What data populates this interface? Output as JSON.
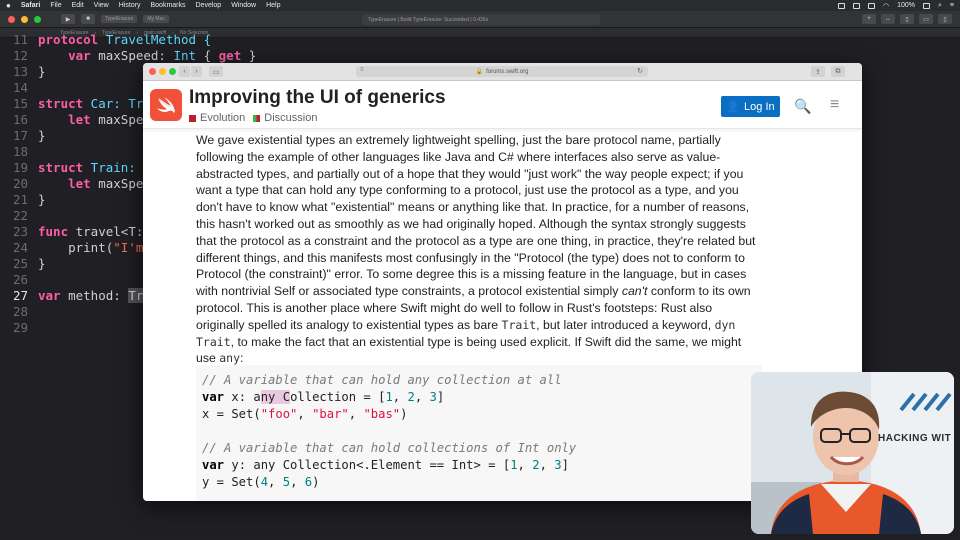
{
  "menubar": {
    "app": "Safari",
    "items": [
      "File",
      "Edit",
      "View",
      "History",
      "Bookmarks",
      "Develop",
      "Window",
      "Help"
    ],
    "battery": "100%",
    "clock": ""
  },
  "xcode": {
    "scheme": "TypeErasure",
    "device": "My Mac",
    "status": "TypeErasure | Build TypeErasure: Succeeded | 0.435s",
    "jump": [
      "TypeErasure",
      "TypeErasure",
      "main.swift",
      "No Selection"
    ]
  },
  "code": [
    {
      "ln": "11",
      "parts": [
        {
          "t": "protocol",
          "c": "kw"
        },
        {
          "t": " TravelMethod {",
          "c": "ty"
        }
      ]
    },
    {
      "ln": "12",
      "parts": [
        {
          "t": "    ",
          "c": "pl"
        },
        {
          "t": "var",
          "c": "kw"
        },
        {
          "t": " maxSpeed: ",
          "c": "pl"
        },
        {
          "t": "Int",
          "c": "ty"
        },
        {
          "t": " { ",
          "c": "pl"
        },
        {
          "t": "get",
          "c": "kw"
        },
        {
          "t": " }",
          "c": "pl"
        }
      ]
    },
    {
      "ln": "13",
      "parts": [
        {
          "t": "}",
          "c": "pl"
        }
      ]
    },
    {
      "ln": "14",
      "parts": []
    },
    {
      "ln": "15",
      "parts": [
        {
          "t": "struct",
          "c": "kw"
        },
        {
          "t": " Car: Tr",
          "c": "ty"
        }
      ]
    },
    {
      "ln": "16",
      "parts": [
        {
          "t": "    ",
          "c": "pl"
        },
        {
          "t": "let",
          "c": "kw"
        },
        {
          "t": " maxSpe",
          "c": "pl"
        }
      ]
    },
    {
      "ln": "17",
      "parts": [
        {
          "t": "}",
          "c": "pl"
        }
      ]
    },
    {
      "ln": "18",
      "parts": []
    },
    {
      "ln": "19",
      "parts": [
        {
          "t": "struct",
          "c": "kw"
        },
        {
          "t": " Train: ",
          "c": "ty"
        }
      ]
    },
    {
      "ln": "20",
      "parts": [
        {
          "t": "    ",
          "c": "pl"
        },
        {
          "t": "let",
          "c": "kw"
        },
        {
          "t": " maxSpe",
          "c": "pl"
        }
      ]
    },
    {
      "ln": "21",
      "parts": [
        {
          "t": "}",
          "c": "pl"
        }
      ]
    },
    {
      "ln": "22",
      "parts": []
    },
    {
      "ln": "23",
      "parts": [
        {
          "t": "func",
          "c": "kw"
        },
        {
          "t": " travel<T:",
          "c": "pl"
        }
      ]
    },
    {
      "ln": "24",
      "parts": [
        {
          "t": "    print(",
          "c": "pl"
        },
        {
          "t": "\"I'm",
          "c": "st"
        }
      ]
    },
    {
      "ln": "25",
      "parts": [
        {
          "t": "}",
          "c": "pl"
        }
      ]
    },
    {
      "ln": "26",
      "parts": []
    },
    {
      "ln": "27",
      "active": true,
      "parts": [
        {
          "t": "var",
          "c": "kw"
        },
        {
          "t": " method: ",
          "c": "pl"
        },
        {
          "t": "Tr",
          "c": "sel"
        }
      ]
    },
    {
      "ln": "28",
      "parts": []
    },
    {
      "ln": "29",
      "parts": []
    }
  ],
  "safari": {
    "address": "forums.swift.org"
  },
  "site": {
    "title": "Improving the UI of generics",
    "categories": [
      {
        "name": "Evolution",
        "color": "#bf1e2e"
      },
      {
        "name": "Discussion",
        "color": "#3ab54a"
      }
    ],
    "login_label": "Log In"
  },
  "post": {
    "p1": "We gave existential types an extremely lightweight spelling, just the bare protocol name, partially following the example of other languages like Java and C# where interfaces also serve as value-abstracted types, and partially out of a hope that they would \"just work\" the way people expect; if you want a type that can hold any type conforming to a protocol, just use the protocol as a type, and you don't have to know what \"existential\" means or anything like that. In practice, for a number of reasons, this hasn't worked out as smoothly as we had originally hoped. Although the syntax strongly suggests that the protocol as a constraint and the protocol as a type are one thing, in practice, they're related but different things, and this manifests most confusingly in the \"Protocol (the type) does not to conform to Protocol (the constraint)\" error. To some degree this is a missing feature in the language, but in cases with nontrivial Self or associated type constraints, a protocol existential simply ",
    "p1_em": "can't",
    "p2": " conform to its own protocol. This is another place where Swift might do well to follow in Rust's footsteps: Rust also originally spelled its analogy to existential types as bare ",
    "code_trait": "Trait",
    "p3": ", but later introduced a keyword, ",
    "code_dyn": "dyn Trait",
    "p4": ", to make the fact that an existential type is being used explicit. If Swift did the same, we might use ",
    "code_any": "any",
    "p5": ":"
  },
  "codeblock": {
    "c1": "// A variable that can hold any collection at all",
    "l2_kw": "var",
    "l2_a": " x: a",
    "l2_hl": "ny C",
    "l2_b": "ollection = [",
    "l2_n1": "1",
    "l2_c1": ", ",
    "l2_n2": "2",
    "l2_c2": ", ",
    "l2_n3": "3",
    "l2_end": "]",
    "l3_a": "x = Set(",
    "l3_s1": "\"foo\"",
    "l3_c1": ", ",
    "l3_s2": "\"bar\"",
    "l3_c2": ", ",
    "l3_s3": "\"bas\"",
    "l3_end": ")",
    "c2": "// A variable that can hold collections of Int only",
    "l6_kw": "var",
    "l6_a": " y: any Collection<.Element == Int> = [",
    "l6_n1": "1",
    "l6_c1": ", ",
    "l6_n2": "2",
    "l6_c2": ", ",
    "l6_n3": "3",
    "l6_end": "]",
    "l7_a": "y = Set(",
    "l7_n1": "4",
    "l7_c1": ", ",
    "l7_n2": "5",
    "l7_c2": ", ",
    "l7_n3": "6",
    "l7_end": ")"
  },
  "webcam": {
    "banner_text": "HACKING WIT"
  }
}
